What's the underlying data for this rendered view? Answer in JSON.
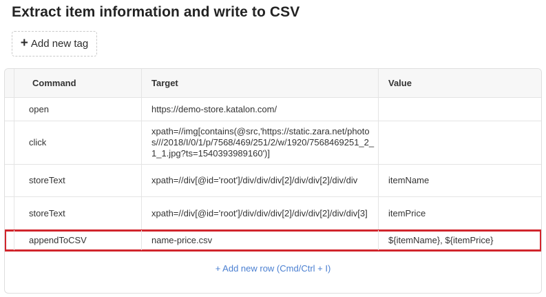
{
  "title": "Extract item information and write to CSV",
  "add_tag": {
    "icon": "plus-icon",
    "label": "Add new tag"
  },
  "table": {
    "columns": [
      "Command",
      "Target",
      "Value"
    ],
    "rows": [
      {
        "command": "open",
        "target": "https://demo-store.katalon.com/",
        "value": ""
      },
      {
        "command": "click",
        "target": "xpath=//img[contains(@src,'https://static.zara.net/photos///2018/I/0/1/p/7568/469/251/2/w/1920/7568469251_2_1_1.jpg?ts=1540393989160')]",
        "value": ""
      },
      {
        "command": "storeText",
        "target": "xpath=//div[@id='root']/div/div/div[2]/div/div[2]/div/div",
        "value": "itemName"
      },
      {
        "command": "storeText",
        "target": "xpath=//div[@id='root']/div/div/div[2]/div/div[2]/div/div[3]",
        "value": "itemPrice"
      },
      {
        "command": "appendToCSV",
        "target": "name-price.csv",
        "value": "${itemName}, ${itemPrice}"
      }
    ],
    "selected_row_index": 4,
    "add_row_label": "+ Add new row (Cmd/Ctrl + I)"
  },
  "colors": {
    "selection_outline": "#d1252c",
    "link": "#4a7fd1"
  }
}
